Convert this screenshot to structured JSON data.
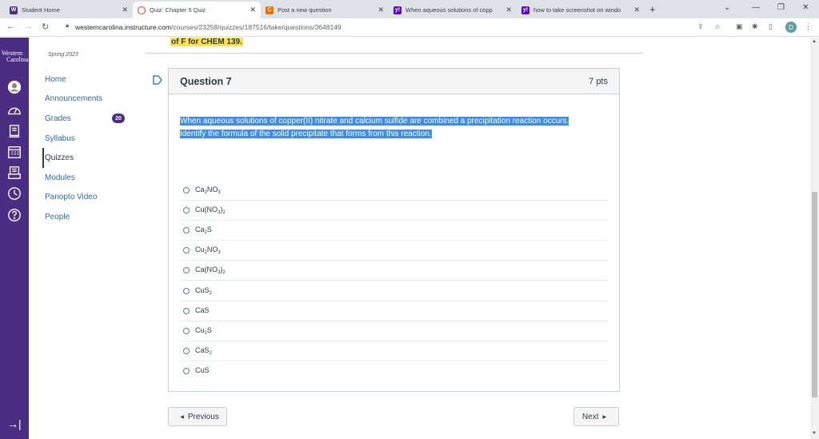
{
  "browser": {
    "tabs": [
      {
        "title": "Student Home",
        "icon": "wcu-icon",
        "color": "#4b2e83",
        "active": false
      },
      {
        "title": "Quiz: Chapter 5 Quiz",
        "icon": "canvas-icon",
        "color": "#e43a1c",
        "active": true
      },
      {
        "title": "Post a new question",
        "icon": "chegg-icon",
        "color": "#eb7100",
        "active": false
      },
      {
        "title": "When aqueous solutions of copp",
        "icon": "yahoo-icon",
        "color": "#6001d2",
        "active": false
      },
      {
        "title": "how to take screenshot on windo",
        "icon": "yahoo-icon",
        "color": "#6001d2",
        "active": false
      }
    ],
    "url_host": "westerncarolina.instructure.com",
    "url_path": "/courses/23258/quizzes/187516/take/questions/3648149",
    "profile_initial": "D"
  },
  "global_nav": {
    "logo_line1": "Western",
    "logo_line2": "Carolina",
    "collapse_icon": "collapse-arrow-icon"
  },
  "course": {
    "term": "Spring 2023",
    "nav": [
      {
        "label": "Home"
      },
      {
        "label": "Announcements"
      },
      {
        "label": "Grades",
        "badge": "20"
      },
      {
        "label": "Syllabus"
      },
      {
        "label": "Quizzes",
        "active": true
      },
      {
        "label": "Modules"
      },
      {
        "label": "Panopto Video"
      },
      {
        "label": "People"
      }
    ]
  },
  "quiz": {
    "banner_fragment": "of F for CHEM 139.",
    "question_title": "Question 7",
    "points": "7 pts",
    "question_line1": "When aqueous solutions of copper(II) nitrate and calcium sulfide are combined a precipitation reaction occurs.",
    "question_line2": "Identify the formula of the solid precipitate that forms from this reaction.",
    "answers": [
      {
        "parts": [
          "Ca",
          "2",
          "NO",
          "3",
          ""
        ]
      },
      {
        "parts": [
          "Cu(NO",
          "3",
          ")",
          "2",
          ""
        ]
      },
      {
        "parts": [
          "Ca",
          "2",
          "S",
          "",
          ""
        ]
      },
      {
        "parts": [
          "Cu",
          "2",
          "NO",
          "3",
          ""
        ]
      },
      {
        "parts": [
          "Ca(NO",
          "3",
          ")",
          "2",
          ""
        ]
      },
      {
        "parts": [
          "CuS",
          "2",
          "",
          "",
          ""
        ]
      },
      {
        "parts": [
          "CaS",
          "",
          "",
          "",
          ""
        ]
      },
      {
        "parts": [
          "Cu",
          "2",
          "S",
          "",
          ""
        ]
      },
      {
        "parts": [
          "CaS",
          "2",
          "",
          "",
          ""
        ]
      },
      {
        "parts": [
          "CuS",
          "",
          "",
          "",
          ""
        ]
      }
    ],
    "previous_label": "Previous",
    "next_label": "Next"
  },
  "colors": {
    "canvas_purple": "#4b2e83",
    "link_blue": "#2d6aa8",
    "selection_blue": "#3d8ce6",
    "highlight_yellow": "#fce14a"
  }
}
